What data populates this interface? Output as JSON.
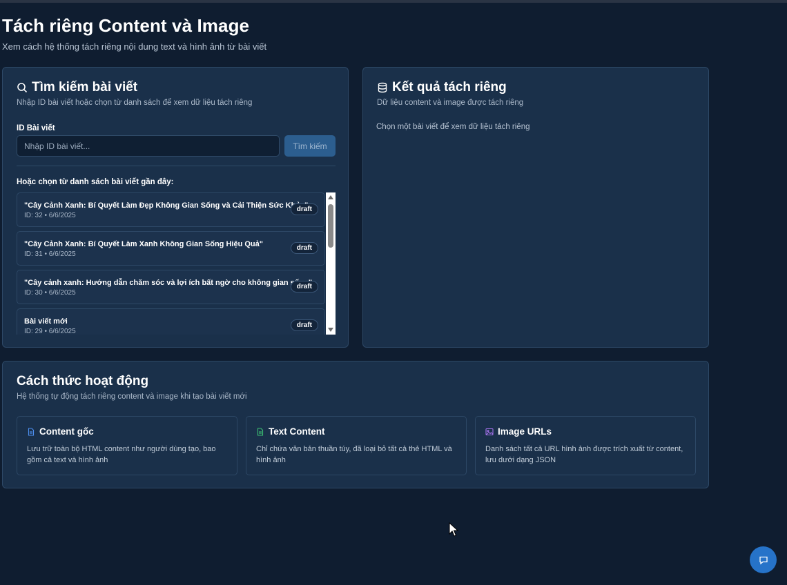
{
  "page": {
    "title": "Tách riêng Content và Image",
    "subtitle": "Xem cách hệ thống tách riêng nội dung text và hình ảnh từ bài viết"
  },
  "search_card": {
    "title": "Tìm kiếm bài viết",
    "description": "Nhập ID bài viết hoặc chọn từ danh sách để xem dữ liệu tách riêng",
    "id_label": "ID Bài viết",
    "id_placeholder": "Nhập ID bài viết...",
    "search_button": "Tìm kiếm",
    "recent_label": "Hoặc chọn từ danh sách bài viết gần đây:",
    "posts": [
      {
        "title": "\"Cây Cảnh Xanh: Bí Quyết Làm Đẹp Không Gian Sống và Cải Thiện Sức Khỏe\"",
        "meta": "ID: 32 • 6/6/2025",
        "status": "draft"
      },
      {
        "title": "\"Cây Cảnh Xanh: Bí Quyết Làm Xanh Không Gian Sống Hiệu Quả\"",
        "meta": "ID: 31 • 6/6/2025",
        "status": "draft"
      },
      {
        "title": "\"Cây cảnh xanh: Hướng dẫn chăm sóc và lợi ích bất ngờ cho không gian sống\"",
        "meta": "ID: 30 • 6/6/2025",
        "status": "draft"
      },
      {
        "title": "Bài viết mới",
        "meta": "ID: 29 • 6/6/2025",
        "status": "draft"
      }
    ]
  },
  "result_card": {
    "title": "Kết quả tách riêng",
    "description": "Dữ liệu content và image được tách riêng",
    "empty_text": "Chọn một bài viết để xem dữ liệu tách riêng"
  },
  "how_card": {
    "title": "Cách thức hoạt động",
    "description": "Hệ thống tự động tách riêng content và image khi tạo bài viết mới",
    "items": [
      {
        "title": "Content gốc",
        "body": "Lưu trữ toàn bộ HTML content như người dùng tạo, bao gồm cả text và hình ảnh",
        "icon": "file-text-icon",
        "color": "#4d8ff0"
      },
      {
        "title": "Text Content",
        "body": "Chỉ chứa văn bản thuần túy, đã loại bỏ tất cả thẻ HTML và hình ảnh",
        "icon": "file-icon",
        "color": "#3cc173"
      },
      {
        "title": "Image URLs",
        "body": "Danh sách tất cả URL hình ảnh được trích xuất từ content, lưu dưới dạng JSON",
        "icon": "image-icon",
        "color": "#a270e8"
      }
    ]
  },
  "colors": {
    "background": "#0f1d30",
    "card": "#1a304a",
    "accent": "#2673c9"
  }
}
